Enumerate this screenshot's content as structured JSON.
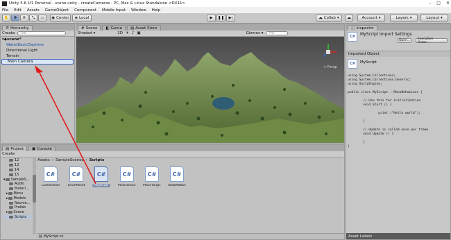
{
  "window": {
    "title": "Unity 5.6.1f1 Personal - scene.unity - createCameras - PC, Mac & Linux Standalone <DX11>",
    "min": "–",
    "max": "□",
    "close": "✕"
  },
  "menu": [
    "File",
    "Edit",
    "Assets",
    "GameObject",
    "Component",
    "Mobile Input",
    "Window",
    "Help"
  ],
  "toolbar": {
    "center": "Center",
    "local": "Local",
    "collab": "Collab",
    "account": "Account",
    "layers": "Layers",
    "layout": "Layout"
  },
  "hierarchy": {
    "tab": "Hierarchy",
    "create": "Create",
    "search_placeholder": "All",
    "scene": "scene*",
    "items": [
      "WaterBasicDaytime",
      "Directional Light",
      "Terrain",
      "Main Camera"
    ]
  },
  "scene_view": {
    "tabs": [
      "Scene",
      "Game",
      "Asset Store"
    ],
    "shading": "Shaded",
    "mode": "2D",
    "gizmos": "Gizmos",
    "search_placeholder": "All",
    "persp": "< Persp"
  },
  "inspector": {
    "tab": "Inspector",
    "title": "MyScript Import Settings",
    "open": "Open...",
    "exec_order": "Execution Order...",
    "imported_object": "Imported Object",
    "object_name": "MyScript",
    "code": "using System.Collections;\nusing System.Collections.Generic;\nusing UnityEngine;\n\npublic class MyScript : MonoBehaviour {\n\n        // Use this for initialization\n        void Start () {\n\n                print (\"Hello world\");\n\n        }\n\n        // Update is called once per frame\n        void Update () {\n\n        }\n}",
    "asset_labels": "Asset Labels"
  },
  "project": {
    "tabs": [
      "Project",
      "Console"
    ],
    "create": "Create",
    "breadcrumb": [
      "Assets",
      "SampleScenes",
      "Scripts"
    ],
    "tree": [
      "12",
      "13",
      "14",
      "15",
      "SampleS...",
      "Audio",
      "Materi...",
      "Menu",
      "Models",
      "Navme...",
      "Prefab",
      "Scene",
      "Scripts"
    ],
    "assets": [
      "CameraSwi...",
      "LevelReset",
      "MyScript",
      "ParticleSce...",
      "PlaceTarge...",
      "SlowMoBut..."
    ],
    "selected_file": "MyScript.cs",
    "cs_glyph": "C#"
  },
  "colors": {
    "arrow": "#e01b1b",
    "selection": "#3b66b8"
  }
}
